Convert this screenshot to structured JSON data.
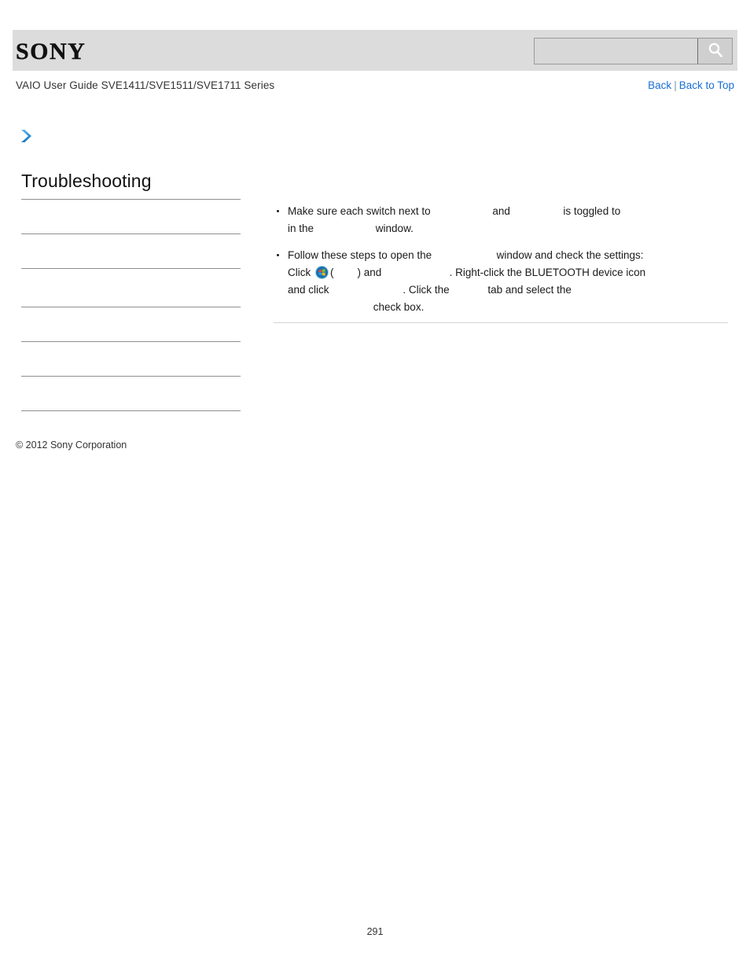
{
  "header": {
    "logo_text": "SONY",
    "logo_icon": "sony-wordmark",
    "search": {
      "value": "",
      "placeholder": "",
      "button_icon": "magnifier-icon"
    }
  },
  "titlebar": {
    "document_title": "VAIO User Guide SVE1411/SVE1511/SVE1711 Series",
    "back_label": "Back",
    "separator": "|",
    "back_to_top_label": "Back to Top",
    "link_color": "#1a6fd4"
  },
  "breadcrumb_icon": "blue-chevron-right-icon",
  "sidebar": {
    "heading": "Troubleshooting",
    "items": [
      {
        "label": ""
      },
      {
        "label": ""
      },
      {
        "label": ""
      },
      {
        "label": ""
      },
      {
        "label": ""
      },
      {
        "label": ""
      }
    ]
  },
  "main": {
    "bullets": [
      {
        "id": "bullet-switches",
        "segments": [
          {
            "type": "text",
            "value": "Make sure each switch next to "
          },
          {
            "type": "gap",
            "value": "                    "
          },
          {
            "type": "text",
            "value": "and "
          },
          {
            "type": "gap",
            "value": "                 "
          },
          {
            "type": "text",
            "value": "is toggled to "
          },
          {
            "type": "break"
          },
          {
            "type": "text",
            "value": "in the "
          },
          {
            "type": "gap",
            "value": "                    "
          },
          {
            "type": "text",
            "value": "window."
          }
        ]
      },
      {
        "id": "bullet-steps",
        "segments": [
          {
            "type": "text",
            "value": "Follow these steps to open the "
          },
          {
            "type": "gap",
            "value": "                     "
          },
          {
            "type": "text",
            "value": "window and check the settings:"
          },
          {
            "type": "break"
          },
          {
            "type": "text",
            "value": "Click "
          },
          {
            "type": "icon",
            "value": "windows-start-orb-icon"
          },
          {
            "type": "text",
            "value": "("
          },
          {
            "type": "gap",
            "value": "        "
          },
          {
            "type": "text",
            "value": ") and "
          },
          {
            "type": "gap",
            "value": "                      "
          },
          {
            "type": "text",
            "value": ". Right-click the BLUETOOTH device icon"
          },
          {
            "type": "break"
          },
          {
            "type": "text",
            "value": "and click "
          },
          {
            "type": "gap",
            "value": "                        "
          },
          {
            "type": "text",
            "value": ". Click the "
          },
          {
            "type": "gap",
            "value": "            "
          },
          {
            "type": "text",
            "value": "tab and select the "
          },
          {
            "type": "break"
          },
          {
            "type": "indent",
            "value": "                             "
          },
          {
            "type": "text",
            "value": "check box."
          }
        ]
      }
    ]
  },
  "footer": {
    "copyright": "© 2012 Sony Corporation",
    "page_number": "291"
  }
}
